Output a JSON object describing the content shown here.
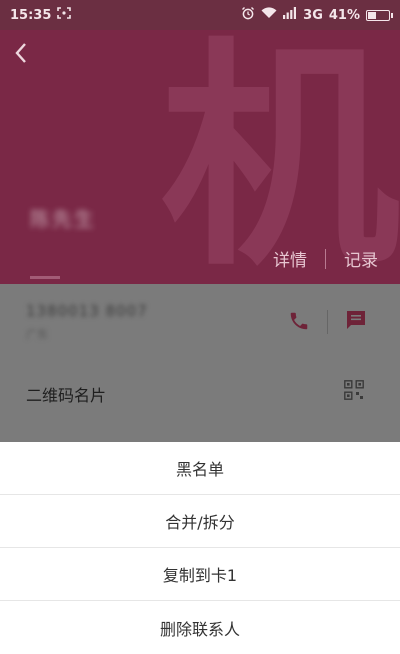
{
  "status_bar": {
    "time": "15:35",
    "network": "3G",
    "battery": "41%",
    "battery_level": 0.41
  },
  "header": {
    "watermark_char": "机",
    "contact_name": "陈先生",
    "tabs": {
      "details": "详情",
      "records": "记录"
    },
    "bg_color": "#7a2846"
  },
  "contact": {
    "phone_number": "1380013 8007",
    "carrier": "广东",
    "qr_label": "二维码名片"
  },
  "action_sheet": {
    "items": [
      "黑名单",
      "合并/拆分",
      "复制到卡1",
      "删除联系人"
    ]
  },
  "icons": {
    "back": "back-arrow-icon",
    "call": "phone-icon",
    "message": "message-icon",
    "qr": "qr-code-icon",
    "alarm": "alarm-icon",
    "wifi": "wifi-icon",
    "signal": "signal-icon",
    "battery": "battery-icon",
    "screenshot": "screenshot-icon"
  }
}
